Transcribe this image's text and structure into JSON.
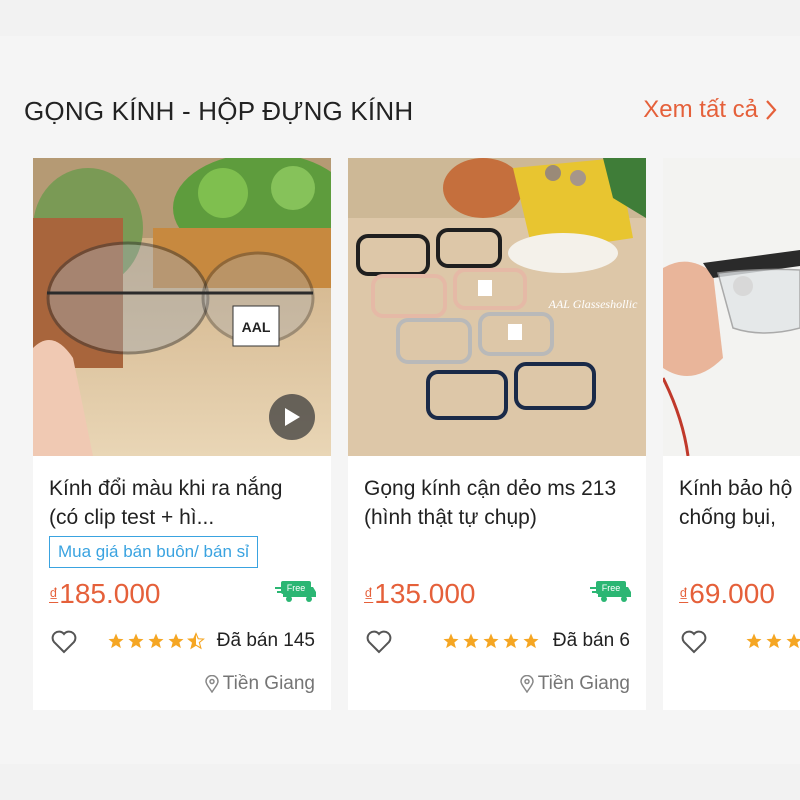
{
  "section": {
    "title": "GỌNG KÍNH - HỘP ĐỰNG KÍNH",
    "see_all": "Xem tất cả"
  },
  "products": [
    {
      "name": "Kính đổi màu khi ra nắng (có clip test + hì...",
      "badge": "Mua giá bán buôn/ bán sỉ",
      "currency": "₫",
      "price": "185.000",
      "free_label": "Free",
      "rating": 4.5,
      "sold": "Đã bán 145",
      "location": "Tiền Giang",
      "has_video": true,
      "image_text": "AAL"
    },
    {
      "name": "Gọng kính cận dẻo ms 213 (hình thật tự chụp)",
      "currency": "₫",
      "price": "135.000",
      "free_label": "Free",
      "rating": 5,
      "sold": "Đã bán 6",
      "location": "Tiền Giang",
      "image_text": "AAL Glasseshollic"
    },
    {
      "name": "Kính bảo hộ chống bụi,",
      "currency": "₫",
      "price": "69.000"
    }
  ],
  "colors": {
    "accent": "#e5603a",
    "badge_blue": "#3aa3e0",
    "star": "#f5a623",
    "free_green": "#2bb673"
  }
}
